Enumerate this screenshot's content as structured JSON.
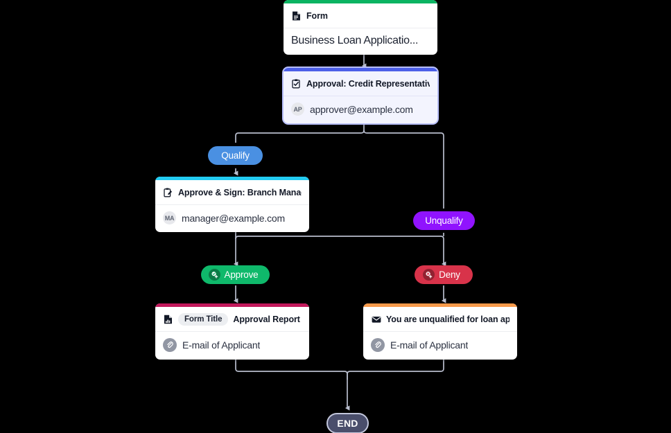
{
  "canvas": {
    "background": "#000000",
    "edge_color": "#b9bece"
  },
  "nodes": {
    "form": {
      "type": "form",
      "accent_color": "#0bb462",
      "icon": "document-icon",
      "title": "Form",
      "body_text": "Business Loan Applicatio..."
    },
    "approval": {
      "type": "approval",
      "accent_color": "#4c5fe8",
      "icon": "approval-clipboard-icon",
      "title": "Approval: Credit Representative",
      "avatar_initials": "AP",
      "body_text": "approver@example.com",
      "selected": true
    },
    "branch_manager": {
      "type": "approve-sign",
      "accent_color": "#22ccf2",
      "icon": "sign-clipboard-icon",
      "title": "Approve & Sign: Branch Manager",
      "avatar_initials": "MA",
      "body_text": "manager@example.com"
    },
    "approval_report": {
      "type": "document",
      "accent_color": "#c2185b",
      "icon": "report-icon",
      "chip_label": "Form Title",
      "title": "Approval Report",
      "attachment_icon": "paperclip-icon",
      "body_text": "E-mail of Applicant"
    },
    "unqualified_email": {
      "type": "email",
      "accent_color": "#f89a4a",
      "icon": "envelope-icon",
      "title": "You are unqualified for loan applic",
      "attachment_icon": "paperclip-icon",
      "body_text": "E-mail of Applicant"
    }
  },
  "pills": {
    "qualify": {
      "label": "Qualify",
      "color": "#4a90e2",
      "has_badge": false
    },
    "unqualify": {
      "label": "Unqualify",
      "color": "#9013fe",
      "has_badge": false
    },
    "approve": {
      "label": "Approve",
      "color": "#0fb96b",
      "has_badge": true,
      "badge_icon": "approve-stamp-icon"
    },
    "deny": {
      "label": "Deny",
      "color": "#d8334a",
      "has_badge": true,
      "badge_icon": "deny-stamp-icon"
    }
  },
  "end_node": {
    "label": "END",
    "background": "#4a4e6b",
    "border_color": "#c3c7dc"
  }
}
